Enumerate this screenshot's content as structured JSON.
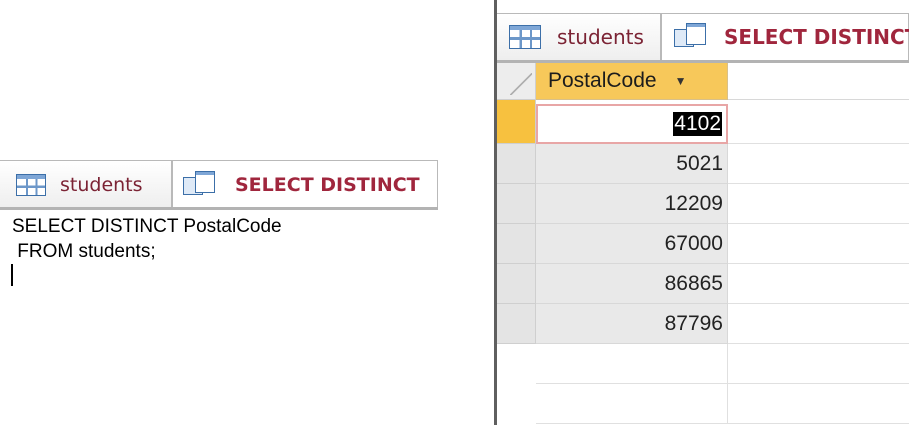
{
  "left_panel": {
    "tabs": [
      {
        "label": "students",
        "icon": "table-icon",
        "active": false
      },
      {
        "label": "SELECT DISTINCT",
        "icon": "query-icon",
        "active": true
      }
    ],
    "sql_lines": [
      "SELECT DISTINCT PostalCode",
      " FROM students;"
    ]
  },
  "right_panel": {
    "tabs": [
      {
        "label": "students",
        "icon": "table-icon",
        "active": false
      },
      {
        "label": "SELECT DISTINCT",
        "icon": "query-icon",
        "active": true
      }
    ],
    "column_header": "PostalCode",
    "column_header_icon": "dropdown-arrow-icon",
    "rows": [
      "4102",
      "5021",
      "12209",
      "67000",
      "86865",
      "87796"
    ],
    "selected_row_index": 0
  },
  "colors": {
    "tab_text": "#7b2334",
    "header_bg": "#f7c85a",
    "current_record_selector": "#f7c13f",
    "selection_bg": "#000000"
  }
}
